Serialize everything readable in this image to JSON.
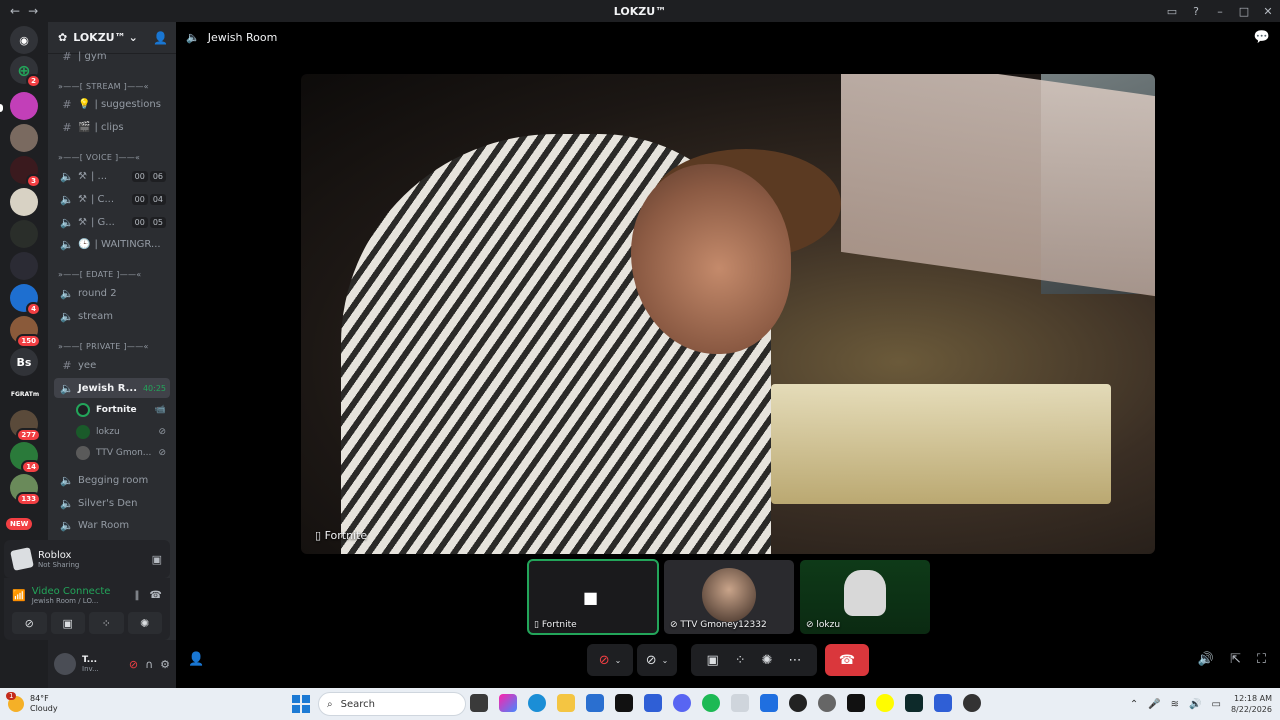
{
  "window": {
    "title": "LOKZU™",
    "back": "←",
    "forward": "→"
  },
  "server": {
    "name": "LOKZU™",
    "chevron": "⌄"
  },
  "channels": {
    "top": "| gym",
    "stream_cat": "»——[ STREAM ]——«",
    "suggestions": "| suggestions",
    "clips": "| clips",
    "voice_cat": "»——[ VOICE ]——«",
    "v1": "| ...",
    "v1_a": "00",
    "v1_b": "06",
    "v2": "| C...",
    "v2_a": "00",
    "v2_b": "04",
    "v3": "| G...",
    "v3_a": "00",
    "v3_b": "05",
    "v4": "| WAITINGR...",
    "edate_cat": "»——[ EDATE ]——«",
    "round2": "round 2",
    "stream": "stream",
    "private_cat": "»——[ PRIVATE ]——«",
    "yee": "yee",
    "jewish": "Jewish R...",
    "timer": "40:25",
    "begging": "Begging room",
    "silver": "Silver's Den",
    "war": "War Room"
  },
  "voice_users": [
    {
      "name": "Fortnite"
    },
    {
      "name": "lokzu"
    },
    {
      "name": "TTV Gmon..."
    }
  ],
  "guild_badges": {
    "b0": "2",
    "b1": "3",
    "b2": "4",
    "b3": "150",
    "b4": "277",
    "b5": "14",
    "b6": "133",
    "new": "NEW",
    "bs": "Bs",
    "fgr": "FGRATm"
  },
  "activity": {
    "title": "Roblox",
    "status": "Not Sharing"
  },
  "voice_panel": {
    "status": "Video Connecte",
    "room": "Jewish Room / LO..."
  },
  "user_panel": {
    "name": "T...",
    "status": "Inv..."
  },
  "header": {
    "channel": "Jewish Room"
  },
  "stage": {
    "label": "Fortnite"
  },
  "tiles": [
    {
      "label": "Fortnite"
    },
    {
      "label": "TTV Gmoney12332"
    },
    {
      "label": "lokzu"
    }
  ],
  "taskbar": {
    "temp": "84°F",
    "weather": "Cloudy",
    "search": "Search",
    "time": "12:18 AM",
    "date": "8/22/2026",
    "notif": "1"
  },
  "colors": {
    "green": "#23a55a",
    "red": "#da373c",
    "blurple": "#5865f2"
  }
}
